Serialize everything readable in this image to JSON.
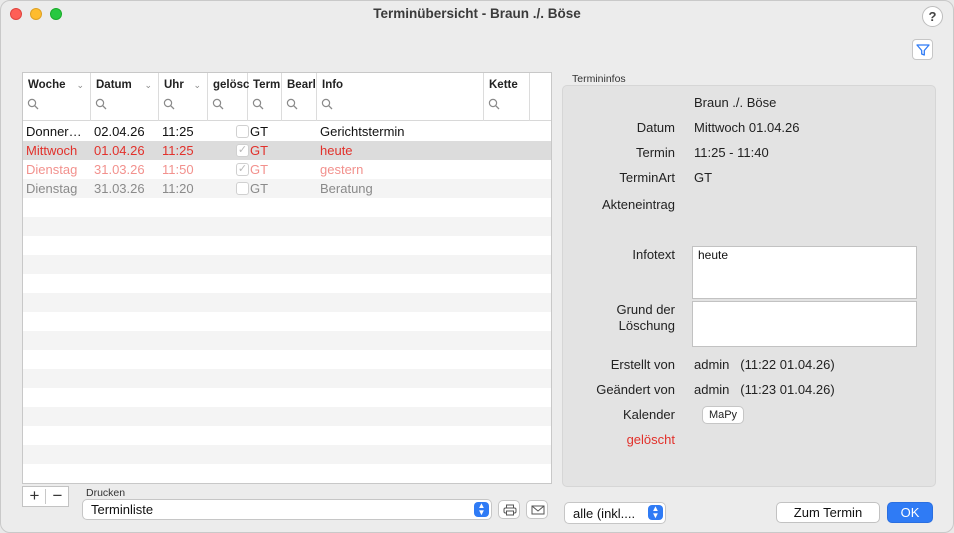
{
  "window": {
    "title": "Terminübersicht - Braun ./. Böse",
    "help_label": "?"
  },
  "table": {
    "columns": [
      {
        "label": "Woche"
      },
      {
        "label": "Datum"
      },
      {
        "label": "Uhr"
      },
      {
        "label": "gelösc"
      },
      {
        "label": "Term"
      },
      {
        "label": "Bearl"
      },
      {
        "label": "Info"
      },
      {
        "label": "Kette"
      }
    ],
    "rows": [
      {
        "woche": "Donner…",
        "datum": "02.04.26",
        "uhr": "11:25",
        "geloescht": false,
        "term": "GT",
        "info": "Gerichtstermin",
        "style": "normal"
      },
      {
        "woche": "Mittwoch",
        "datum": "01.04.26",
        "uhr": "11:25",
        "geloescht": true,
        "term": "GT",
        "info": "heute",
        "style": "today"
      },
      {
        "woche": "Dienstag",
        "datum": "31.03.26",
        "uhr": "11:50",
        "geloescht": true,
        "term": "GT",
        "info": "gestern",
        "style": "past"
      },
      {
        "woche": "Dienstag",
        "datum": "31.03.26",
        "uhr": "11:20",
        "geloescht": false,
        "term": "GT",
        "info": "Beratung",
        "style": "gray"
      }
    ]
  },
  "bottom": {
    "plus_label": "+",
    "minus_label": "−",
    "drucken_label": "Drucken",
    "drucken_value": "Terminliste",
    "filter_value": "alle (inkl....",
    "zum_termin_label": "Zum Termin",
    "ok_label": "OK"
  },
  "info": {
    "group_label": "Termininfos",
    "akte": "Braun ./. Böse",
    "datum_label": "Datum",
    "datum_value": "Mittwoch 01.04.26",
    "termin_label": "Termin",
    "termin_value": "11:25 - 11:40",
    "terminart_label": "TerminArt",
    "terminart_value": "GT",
    "akteneintrag_label": "Akteneintrag",
    "infotext_label": "Infotext",
    "infotext_value": "heute",
    "grund_label_1": "Grund der",
    "grund_label_2": "Löschung",
    "grund_value": "",
    "erstellt_label": "Erstellt von",
    "erstellt_value": "admin   (11:22 01.04.26)",
    "geaendert_label": "Geändert von",
    "geaendert_value": "admin   (11:23 01.04.26)",
    "kalender_label": "Kalender",
    "kalender_value": "MaPy",
    "geloescht_label": "gelöscht"
  },
  "colors": {
    "accent": "#2f7bf5",
    "today": "#e2312b",
    "past": "#f2918d"
  }
}
